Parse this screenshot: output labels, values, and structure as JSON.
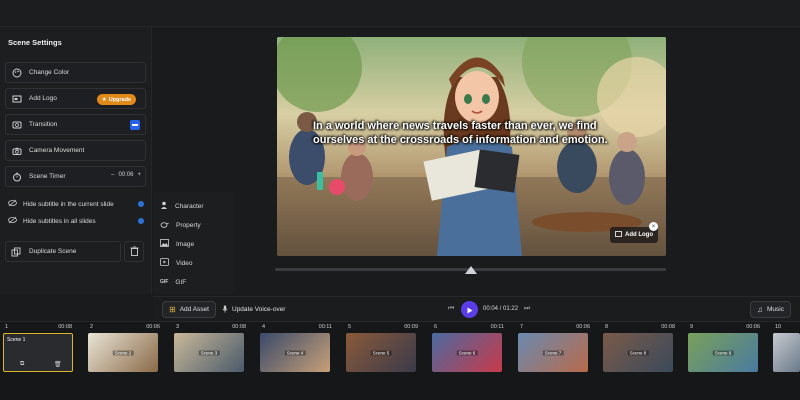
{
  "scene_settings": {
    "title": "Scene Settings",
    "change_color": "Change Color",
    "add_logo": "Add Logo",
    "upgrade": "Upgrade",
    "transition": "Transition",
    "camera_movement": "Camera Movement",
    "scene_timer": "Scene Timer",
    "scene_timer_value": "00:06",
    "hide_current": "Hide subtitle in the current slide",
    "hide_all": "Hide subtitles in all slides",
    "duplicate": "Duplicate Scene"
  },
  "add_menu": {
    "items": [
      {
        "label": "Character",
        "icon": "person-icon"
      },
      {
        "label": "Property",
        "icon": "teapot-icon"
      },
      {
        "label": "Image",
        "icon": "image-icon"
      },
      {
        "label": "Video",
        "icon": "video-icon"
      },
      {
        "label": "GIF",
        "icon": "gif-icon"
      }
    ]
  },
  "stage": {
    "subtitle": "In a world where news travels faster than ever, we find ourselves at the crossroads of information and emotion.",
    "add_logo": "Add Logo"
  },
  "controls": {
    "add_asset": "Add Asset",
    "update_voice": "Update Voice-over",
    "time": "00:04 / 01:22",
    "music": "Music"
  },
  "timeline": {
    "scenes": [
      {
        "num": "1",
        "dur": "00:08",
        "label": "Scene 1"
      },
      {
        "num": "2",
        "dur": "00:06",
        "label": "Scene 2"
      },
      {
        "num": "3",
        "dur": "00:08",
        "label": "Scene 3"
      },
      {
        "num": "4",
        "dur": "00:11",
        "label": "Scene 4"
      },
      {
        "num": "5",
        "dur": "00:09",
        "label": "Scene 5"
      },
      {
        "num": "6",
        "dur": "00:11",
        "label": "Scene 6"
      },
      {
        "num": "7",
        "dur": "00:06",
        "label": "Scene 7"
      },
      {
        "num": "8",
        "dur": "00:08",
        "label": "Scene 8"
      },
      {
        "num": "9",
        "dur": "00:06",
        "label": "Scene 9"
      },
      {
        "num": "10",
        "dur": "",
        "label": ""
      }
    ]
  },
  "colors": {
    "accent": "#2563eb",
    "upgrade": "#e08a1a",
    "play": "#5b3de8",
    "selected": "#d9b52b"
  }
}
